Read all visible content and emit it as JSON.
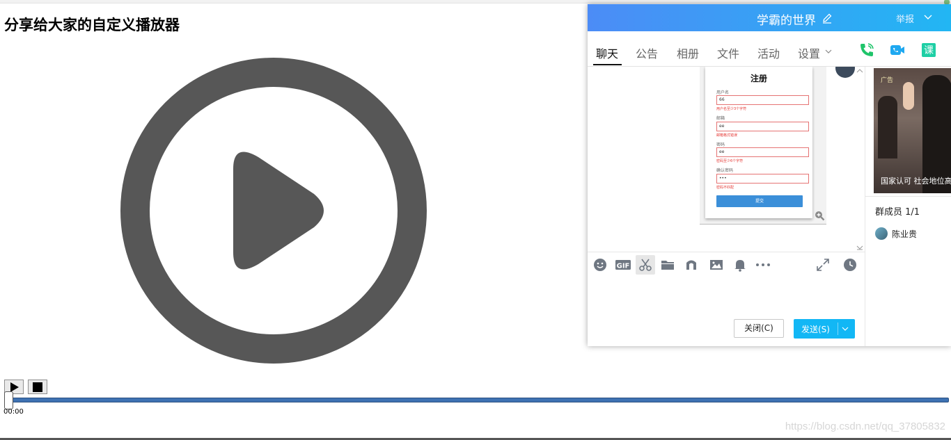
{
  "page": {
    "title": "分享给大家的自定义播放器",
    "watermark": "https://blog.csdn.net/qq_37805832"
  },
  "player": {
    "current_time": "00:00",
    "progress": 0,
    "play_icon": "play-icon",
    "stop_icon": "stop-icon",
    "icon_color": "#575757",
    "track_color": "#3e72b2"
  },
  "chat": {
    "header": {
      "group_name": "学霸的世界",
      "report_label": "举报",
      "colors": {
        "gradient_start": "#4c8cf6",
        "gradient_end": "#22b6f3"
      }
    },
    "tabs": [
      {
        "label": "聊天",
        "active": true
      },
      {
        "label": "公告",
        "active": false
      },
      {
        "label": "相册",
        "active": false
      },
      {
        "label": "文件",
        "active": false
      },
      {
        "label": "活动",
        "active": false
      },
      {
        "label": "设置",
        "active": false
      }
    ],
    "tools": {
      "phone_icon": "phone-icon",
      "video_icon": "video-call-icon",
      "class_label": "课"
    },
    "message_image": {
      "title": "注册",
      "fields": [
        {
          "label": "用户名",
          "value": "66",
          "error": "用户名至少3个字符"
        },
        {
          "label": "邮箱",
          "value": "ee",
          "error": "邮箱格式错误"
        },
        {
          "label": "密码",
          "value": "ee",
          "error": "密码至少6个字符"
        },
        {
          "label": "确认密码",
          "value": "•••",
          "error": "密码不匹配"
        }
      ],
      "submit_label": "提交"
    },
    "input_toolbar_icons": [
      "emoji-icon",
      "gif-icon",
      "scissors-icon",
      "folder-icon",
      "music-icon",
      "image-icon",
      "bell-icon",
      "more-icon",
      "expand-icon",
      "history-icon"
    ],
    "gif_label": "GIF",
    "close_label": "关闭(C)",
    "send_label": "发送(S)",
    "send_color": "#12b7f5"
  },
  "side": {
    "ad_badge": "广告",
    "ad_caption": "国家认可 社会地位高",
    "members_title": "群成员 1/1",
    "members": [
      {
        "name": "陈业贵"
      }
    ]
  }
}
